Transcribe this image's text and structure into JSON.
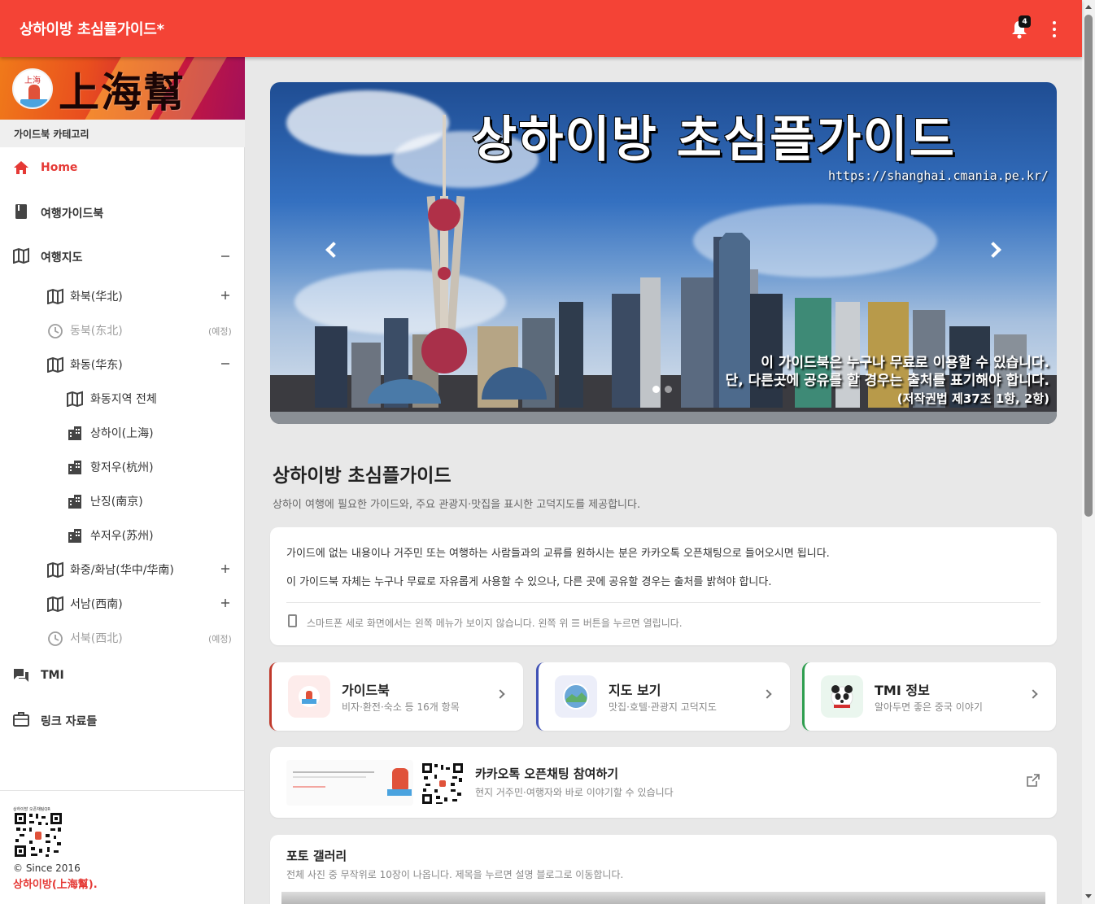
{
  "appbar": {
    "title": "상하이방 초심플가이드*",
    "notification_count": "4"
  },
  "sidebar": {
    "brand_logo_text": "上海幫",
    "brand_badge_text": "上海",
    "category_header": "가이드북 카테고리",
    "items": [
      {
        "label": "Home"
      },
      {
        "label": "여행가이드북"
      },
      {
        "label": "여행지도"
      },
      {
        "label": "화북(华北)"
      },
      {
        "label": "동북(东北)",
        "note": "(예정)"
      },
      {
        "label": "화동(华东)"
      },
      {
        "label": "화동지역 전체"
      },
      {
        "label": "상하이(上海)"
      },
      {
        "label": "항저우(杭州)"
      },
      {
        "label": "난징(南京)"
      },
      {
        "label": "쑤저우(苏州)"
      },
      {
        "label": "화중/화남(华中/华南)"
      },
      {
        "label": "서남(西南)"
      },
      {
        "label": "서북(西北)",
        "note": "(예정)"
      },
      {
        "label": "TMI"
      },
      {
        "label": "링크 자료들"
      }
    ],
    "footer": {
      "qr_caption": "상하이방 오픈채팅QR",
      "since": "© Since 2016",
      "brand": "상하이방(上海幫)."
    }
  },
  "hero": {
    "title": "상하이방 초심플가이드",
    "url": "https://shanghai.cmania.pe.kr/",
    "notice_line1": "이 가이드북은 누구나 무료로 이용할 수 있습니다.",
    "notice_line2": "단, 다른곳에 공유를 할 경우는 출처를 표기해야 합니다.",
    "notice_line3": "(저작권법 제37조 1항, 2항)"
  },
  "main": {
    "title": "상하이방 초심플가이드",
    "subtitle": "상하이 여행에 필요한 가이드와, 주요 관광지·맛집을 표시한 고덕지도를 제공합니다.",
    "info": {
      "line1": "가이드에 없는 내용이나 거주민 또는 여행하는 사람들과의 교류를 원하시는 분은 카카오톡 오픈채팅으로 들어오시면 됩니다.",
      "line2": "이 가이드북 자체는 누구나 무료로 자유롭게 사용할 수 있으나, 다른 곳에 공유할 경우는 출처를 밝혀야 합니다.",
      "note": "스마트폰 세로 화면에서는 왼쪽 메뉴가 보이지 않습니다. 왼쪽 위 ☰ 버튼을 누르면 열립니다."
    },
    "features": [
      {
        "title": "가이드북",
        "subtitle": "비자·환전·숙소 등 16개 항목",
        "color": "#c0392b"
      },
      {
        "title": "지도 보기",
        "subtitle": "맛집·호텔·관광지 고덕지도",
        "color": "#3f51b5"
      },
      {
        "title": "TMI 정보",
        "subtitle": "알아두면 좋은 중국 이야기",
        "color": "#2e9e4f"
      }
    ],
    "kakao": {
      "title": "카카오톡 오픈채팅 참여하기",
      "subtitle": "현지 거주민·여행자와 바로 이야기할 수 있습니다",
      "qr_caption": "상하이방 오픈채팅QR"
    },
    "gallery": {
      "title": "포토 갤러리",
      "subtitle": "전체 사진 중 무작위로 10장이 나옵니다. 제목을 누르면 설명 블로그로 이동합니다."
    }
  },
  "colors": {
    "primary": "#f44336",
    "active": "#e53935"
  }
}
